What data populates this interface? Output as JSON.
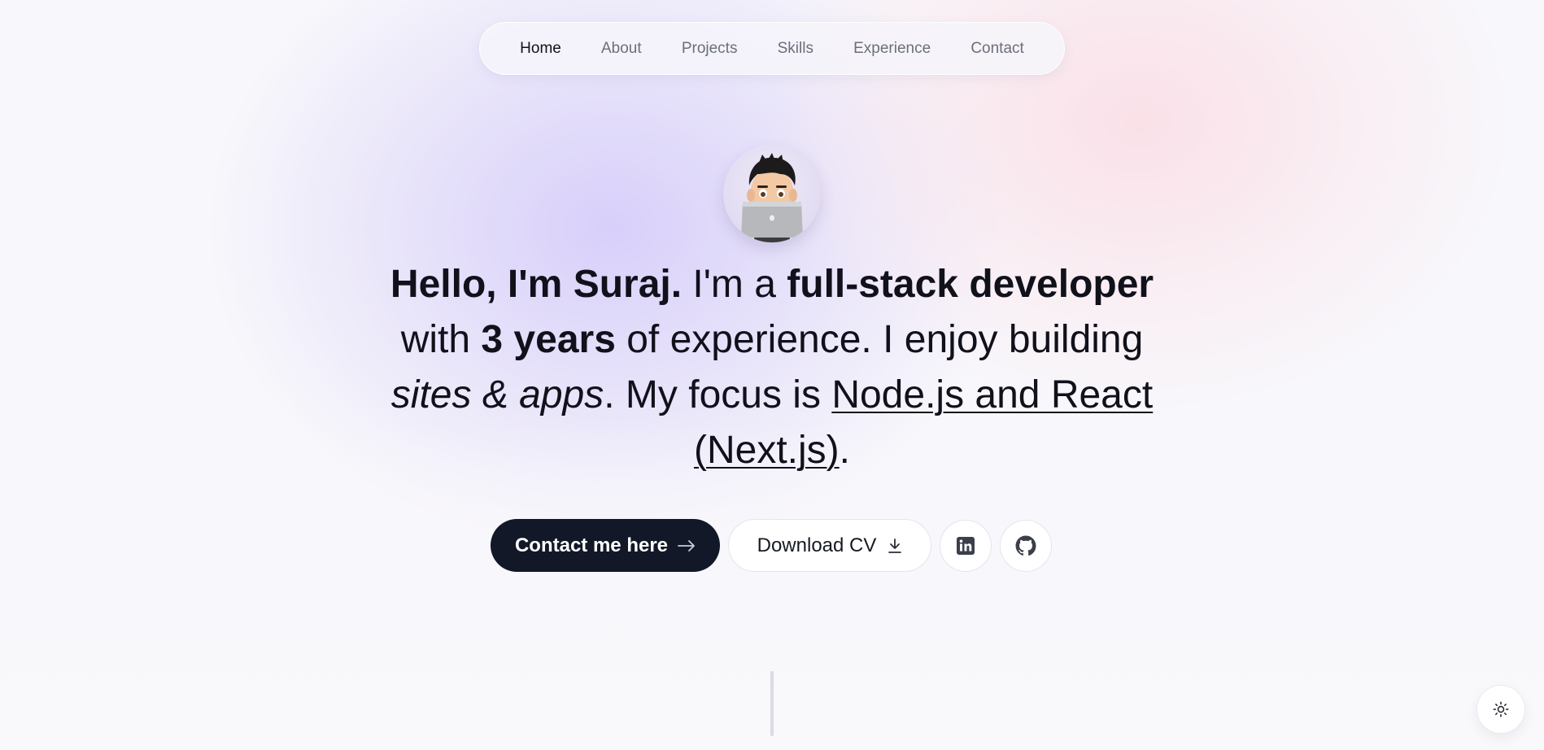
{
  "nav": {
    "items": [
      {
        "label": "Home",
        "active": true
      },
      {
        "label": "About",
        "active": false
      },
      {
        "label": "Projects",
        "active": false
      },
      {
        "label": "Skills",
        "active": false
      },
      {
        "label": "Experience",
        "active": false
      },
      {
        "label": "Contact",
        "active": false
      }
    ]
  },
  "hero": {
    "greeting": "Hello, I'm Suraj.",
    "im_a": " I'm a ",
    "role": "full-stack developer",
    "with": " with ",
    "years": "3 years",
    "of_experience": " of experience. I enjoy building ",
    "builds": "sites & apps",
    "focus_intro": ". My focus is ",
    "focus": "Node.js and React (Next.js)",
    "end": "."
  },
  "actions": {
    "contact_label": "Contact me here",
    "contact_icon": "arrow-right-icon",
    "cv_label": "Download CV",
    "cv_icon": "download-icon",
    "linkedin_icon": "linkedin-icon",
    "github_icon": "github-icon"
  },
  "theme_toggle": {
    "icon": "sun-icon"
  },
  "colors": {
    "primary_button": "#121827",
    "text": "#11111c",
    "nav_inactive": "#6b6f7a"
  }
}
